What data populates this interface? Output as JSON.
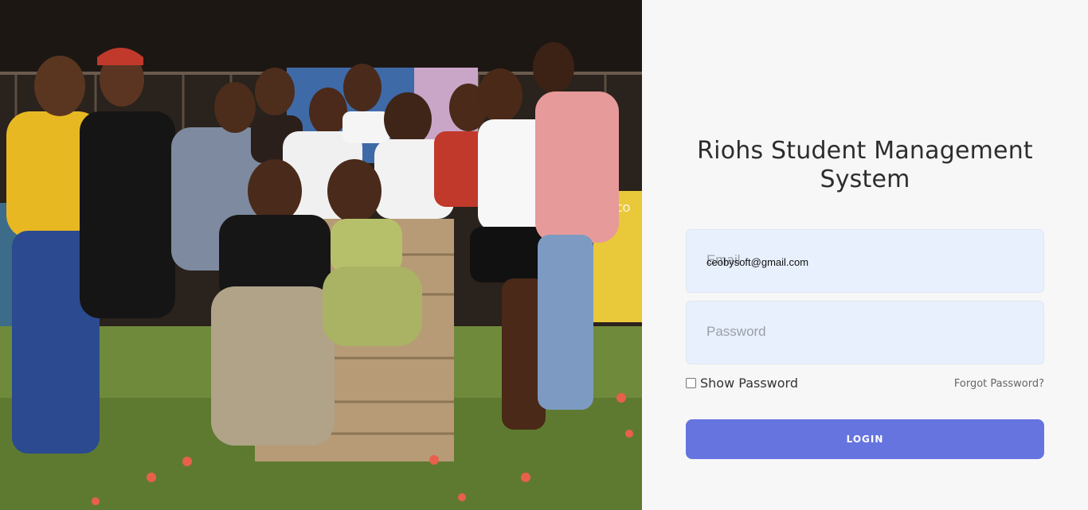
{
  "app": {
    "title": "Riohs Student Management System"
  },
  "photo": {
    "name": "group-photo",
    "mural_text": "S.CO"
  },
  "form": {
    "email": {
      "placeholder": "Email",
      "value": "ceobysoft@gmail.com"
    },
    "password": {
      "placeholder": "Password",
      "value": ""
    },
    "show_password_label": "Show Password",
    "show_password_checked": false,
    "forgot_password_label": "Forgot Password?",
    "login_label": "LOGIN"
  },
  "colors": {
    "accent": "#6674e0",
    "input_bg": "#e8f0fe",
    "panel_bg": "#f7f7f7"
  }
}
